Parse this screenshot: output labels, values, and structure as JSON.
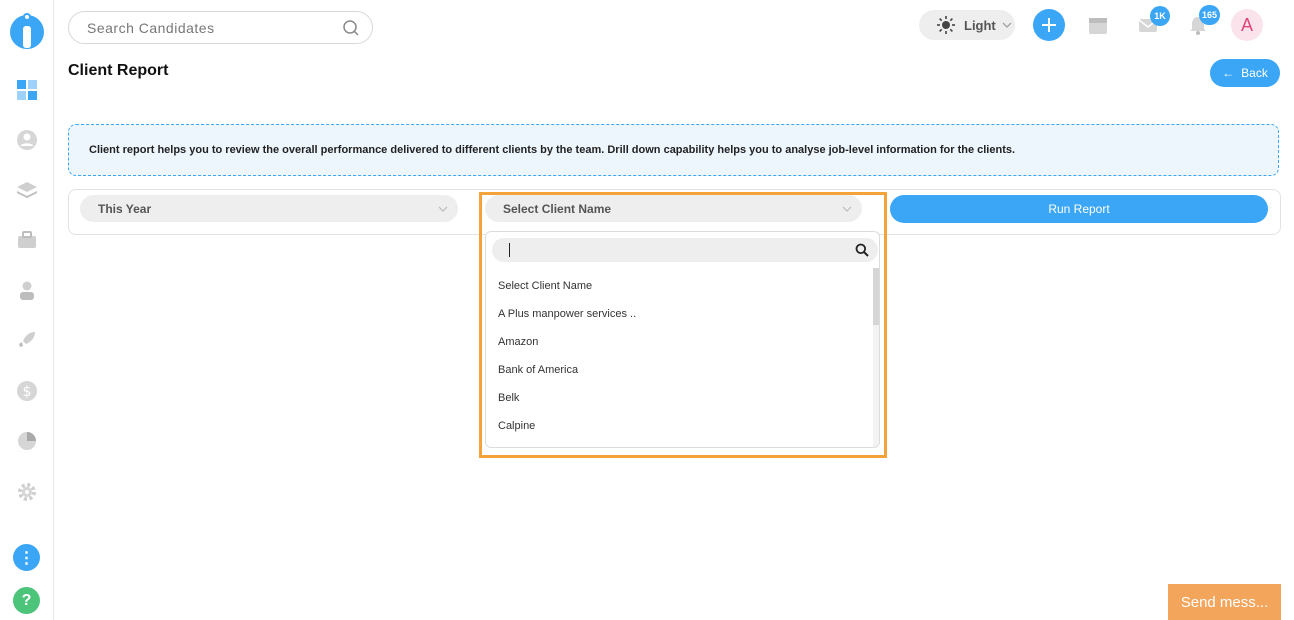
{
  "header": {
    "search_placeholder": "Search Candidates",
    "theme_label": "Light",
    "mail_badge": "1K",
    "notification_badge": "165",
    "avatar_initial": "A"
  },
  "page": {
    "title": "Client Report",
    "back_label": "Back",
    "info_text": "Client report helps you to review the overall performance delivered to different clients by the team. Drill down capability helps you to analyse job-level information for the clients."
  },
  "filters": {
    "period_value": "This Year",
    "client_value": "Select Client Name",
    "run_label": "Run Report"
  },
  "dropdown": {
    "items": [
      "Select Client Name",
      "A Plus manpower services ..",
      "Amazon",
      "Bank of America",
      "Belk",
      "Calpine"
    ]
  },
  "chat": {
    "label": "Send mess..."
  },
  "colors": {
    "accent": "#3aa6f5",
    "highlight": "#f4a23a",
    "chat": "#f4a55c",
    "help": "#4cc47a"
  }
}
